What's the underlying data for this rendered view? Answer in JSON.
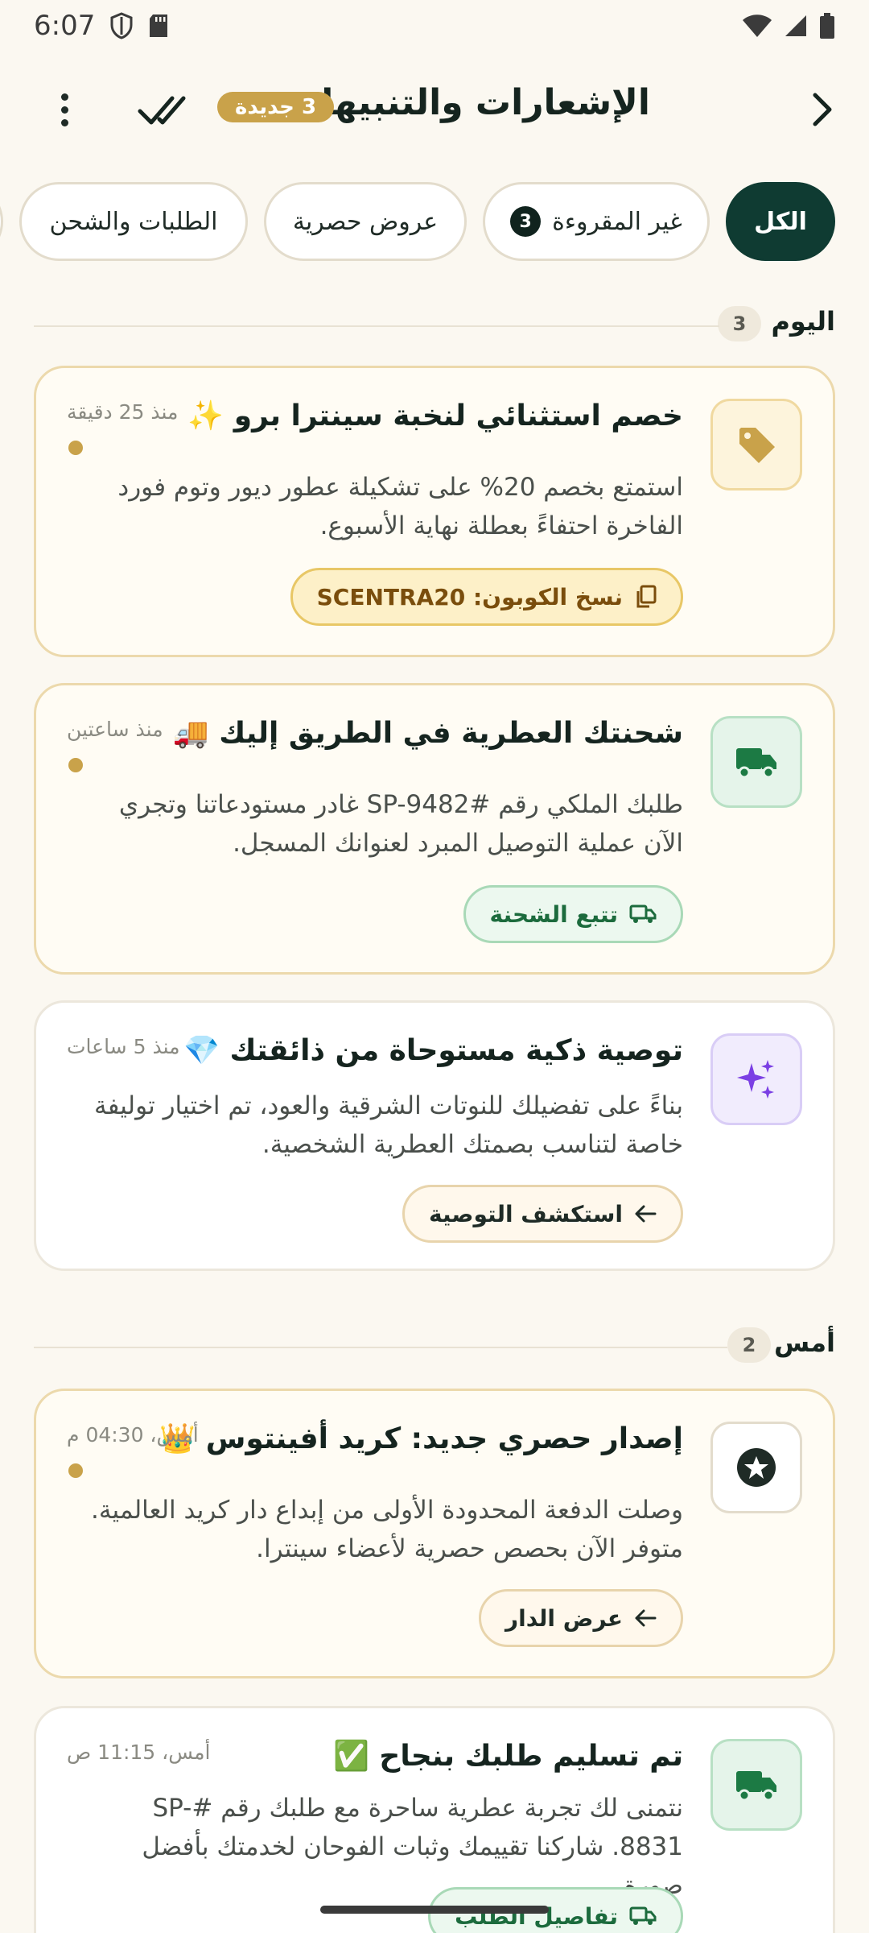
{
  "status_bar": {
    "time": "6:07"
  },
  "header": {
    "title": "الإشعارات والتنبيهات",
    "new_badge": "3 جديدة"
  },
  "filters": [
    {
      "label": "الكل"
    },
    {
      "label": "غير المقروءة",
      "count": "3"
    },
    {
      "label": "عروض حصرية"
    },
    {
      "label": "الطلبات والشحن"
    }
  ],
  "sections": [
    {
      "title": "اليوم",
      "count": "3"
    },
    {
      "title": "أمس",
      "count": "2"
    }
  ],
  "notifications": [
    {
      "icon": "tag-icon",
      "title": "خصم استثنائي لنخبة سينترا برو ✨",
      "time": "منذ 25 دقيقة",
      "body": "استمتع بخصم 20% على تشكيلة عطور ديور وتوم فورد الفاخرة احتفاءً بعطلة نهاية الأسبوع.",
      "action": "نسخ الكوبون: SCENTRA20",
      "unread": true
    },
    {
      "icon": "truck-icon",
      "title": "شحنتك العطرية في الطريق إليك 🚚",
      "time": "منذ ساعتين",
      "body": "طلبك الملكي رقم #SP-9482 غادر مستودعاتنا وتجري الآن عملية التوصيل المبرد لعنوانك المسجل.",
      "action": "تتبع الشحنة",
      "unread": true
    },
    {
      "icon": "sparkles-icon",
      "title": "توصية ذكية مستوحاة من ذائقتك 💎",
      "time": "منذ 5 ساعات",
      "body": "بناءً على تفضيلك للنوتات الشرقية والعود، تم اختيار توليفة خاصة لتناسب بصمتك العطرية الشخصية.",
      "action": "استكشف التوصية",
      "unread": false
    },
    {
      "icon": "star-icon",
      "title": "إصدار حصري جديد: كريد أفينتوس 👑",
      "time": "أمس، 04:30 م",
      "body": "وصلت الدفعة المحدودة الأولى من إبداع دار كريد العالمية. متوفر الآن بحصص حصرية لأعضاء سينترا.",
      "action": "عرض الدار",
      "unread": true
    },
    {
      "icon": "truck-icon",
      "title": "تم تسليم طلبك بنجاح ✅",
      "time": "أمس، 11:15 ص",
      "body": "نتمنى لك تجربة عطرية ساحرة مع طلبك رقم #SP-8831. شاركنا تقييمك وثبات الفوحان لخدمتك بأفضل صورة.",
      "action": "تفاصيل الطلب",
      "unread": false
    }
  ]
}
